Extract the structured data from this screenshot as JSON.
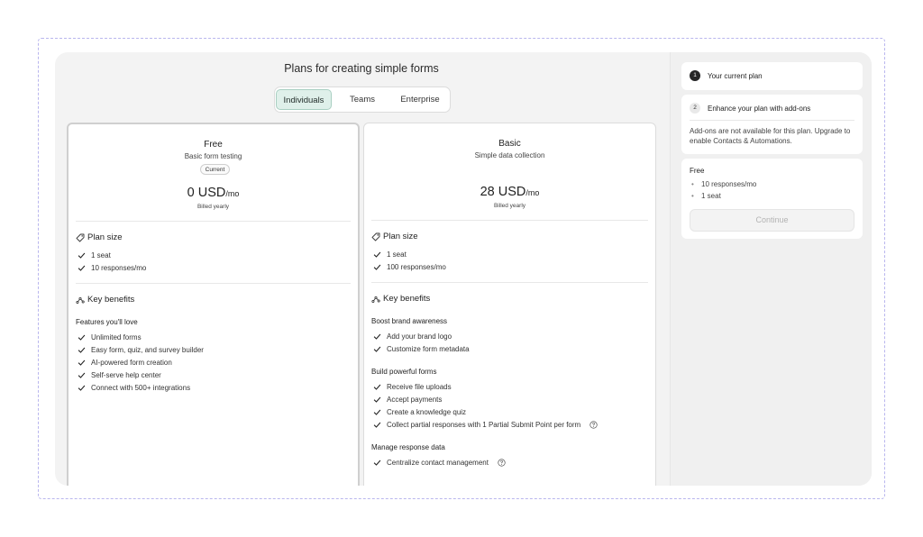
{
  "title": "Plans for creating simple forms",
  "tabs": [
    {
      "label": "Individuals",
      "active": true
    },
    {
      "label": "Teams",
      "active": false
    },
    {
      "label": "Enterprise",
      "active": false
    }
  ],
  "plans": [
    {
      "name": "Free",
      "description": "Basic form testing",
      "badge": "Current",
      "price": "0 USD",
      "per": "/mo",
      "billing": "Billed yearly",
      "plan_size_title": "Plan size",
      "plan_size": [
        "1 seat",
        "10 responses/mo"
      ],
      "benefits_title": "Key benefits",
      "groups": [
        {
          "title": "Features you'll love",
          "items": [
            "Unlimited forms",
            "Easy form, quiz, and survey builder",
            "AI-powered form creation",
            "Self-serve help center",
            "Connect with 500+ integrations"
          ]
        }
      ]
    },
    {
      "name": "Basic",
      "description": "Simple data collection",
      "price": "28 USD",
      "per": "/mo",
      "billing": "Billed yearly",
      "plan_size_title": "Plan size",
      "plan_size": [
        "1 seat",
        "100 responses/mo"
      ],
      "benefits_title": "Key benefits",
      "groups": [
        {
          "title": "Boost brand awareness",
          "items": [
            "Add your brand logo",
            "Customize form metadata"
          ]
        },
        {
          "title": "Build powerful forms",
          "items": [
            "Receive file uploads",
            "Accept payments",
            "Create a knowledge quiz",
            "Collect partial responses with 1 Partial Submit Point per form"
          ]
        },
        {
          "title": "Manage response data",
          "items": [
            "Centralize contact management"
          ]
        }
      ]
    }
  ],
  "sidebar": {
    "step1": {
      "number": "1",
      "label": "Your current plan"
    },
    "step2": {
      "number": "2",
      "label": "Enhance your plan with add-ons",
      "note": "Add-ons are not available for this plan. Upgrade to enable Contacts & Automations."
    },
    "summary": {
      "title": "Free",
      "items": [
        "10 responses/mo",
        "1 seat"
      ]
    },
    "continue_label": "Continue"
  },
  "colors": {
    "active_tab_bg": "#dff0ea",
    "active_tab_border": "#a9cfc2",
    "step1_badge": "#262627"
  }
}
